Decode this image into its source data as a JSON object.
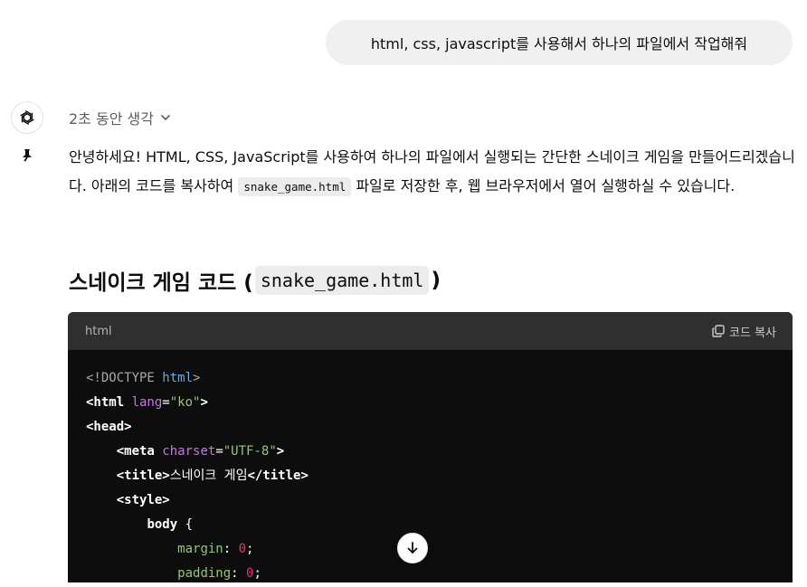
{
  "user_message": "html, css, javascript를 사용해서 하나의 파일에서 작업해줘",
  "thought": {
    "label": "2초 동안 생각"
  },
  "answer": {
    "para_before_code": "안녕하세요! HTML, CSS, JavaScript를 사용하여 하나의 파일에서 실행되는 간단한 스네이크 게임을 만들어드리겠습니다. 아래의 코드를 복사하여 ",
    "inline_code": "snake_game.html",
    "para_after_code": " 파일로 저장한 후, 웹 브라우저에서 열어 실행하실 수 있습니다."
  },
  "heading": {
    "text": "스네이크 게임 코드 (",
    "code": "snake_game.html",
    "close": ")"
  },
  "code_block": {
    "language": "html",
    "copy_label": "코드 복사",
    "lines": {
      "l1": {
        "open": "<!DOCTYPE ",
        "kw": "html",
        "close": ">"
      },
      "l2": {
        "open": "<html ",
        "attr": "lang",
        "eq": "=",
        "val": "\"ko\"",
        "close": ">"
      },
      "l3": {
        "tag": "<head>"
      },
      "l4": {
        "indent": "    ",
        "open": "<meta ",
        "attr": "charset",
        "eq": "=",
        "val": "\"UTF-8\"",
        "close": ">"
      },
      "l5": {
        "indent": "    ",
        "open": "<title>",
        "text": "스네이크 게임",
        "close": "</title>"
      },
      "l6": {
        "indent": "    ",
        "tag": "<style>"
      },
      "l7": {
        "indent": "        ",
        "sel": "body",
        "brace": " {"
      },
      "l8": {
        "indent": "            ",
        "prop": "margin",
        "colon": ": ",
        "num": "0",
        "semi": ";"
      },
      "l9": {
        "indent": "            ",
        "prop": "padding",
        "colon": ": ",
        "num": "0",
        "semi": ";"
      }
    }
  },
  "colors": {
    "accent_code_bg": "#0d0d0d",
    "code_header_bg": "#2f2f2f",
    "user_bubble_bg": "#f0f0f0"
  },
  "icons": {
    "assistant_avatar": "openai-logo-icon",
    "pin": "pin-icon",
    "chevron": "chevron-down-icon",
    "copy": "copy-icon",
    "scroll": "arrow-down-icon"
  }
}
